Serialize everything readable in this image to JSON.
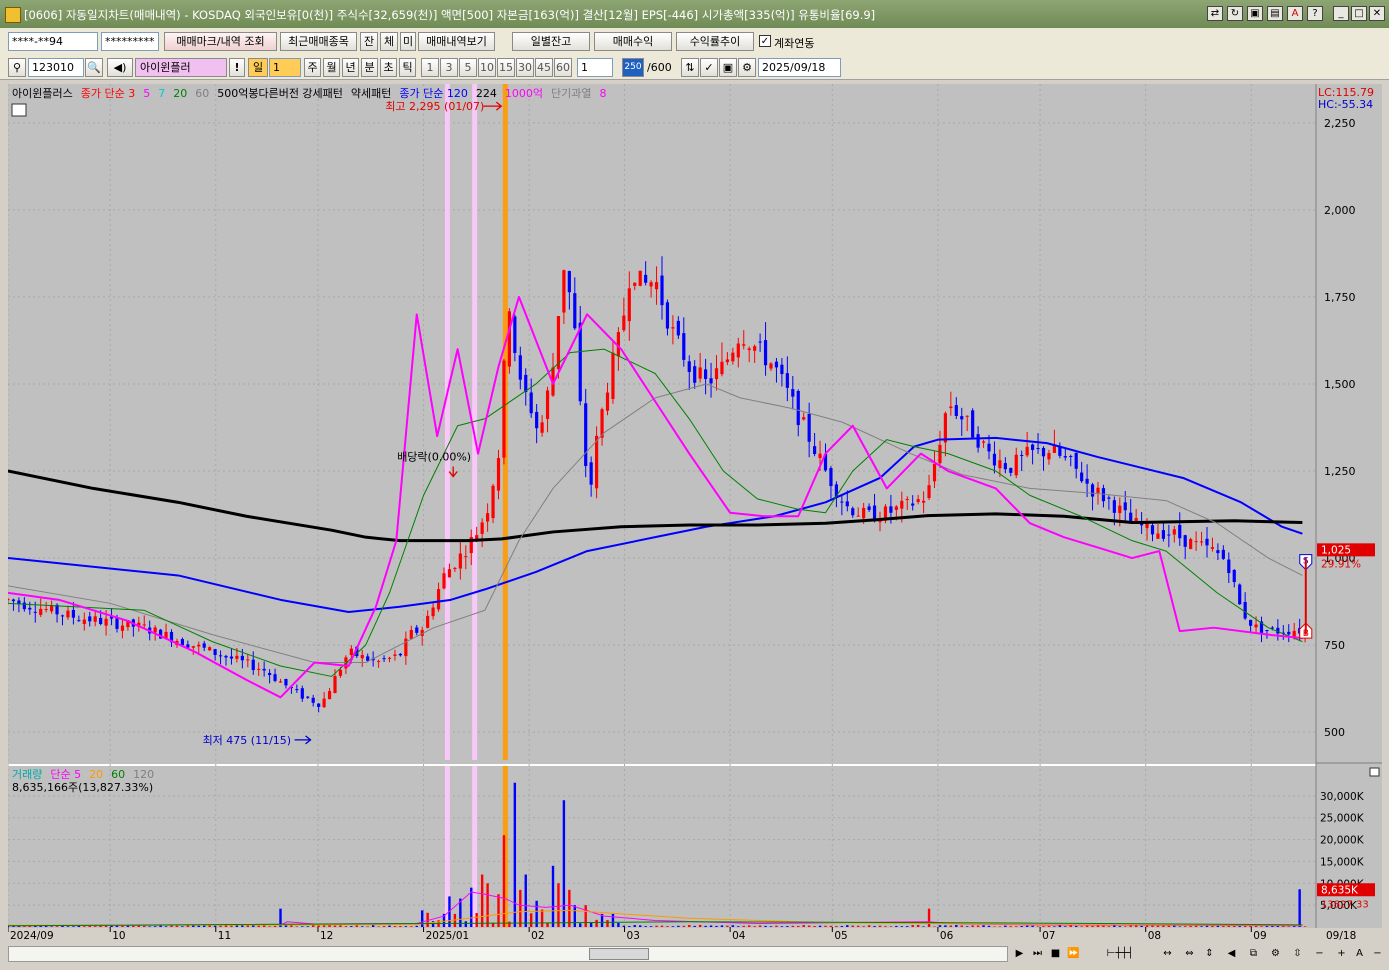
{
  "window": {
    "title": "[0606] 자동일지차트(매매내역) - KOSDAQ 외국인보유[0(천)] 주식수[32,659(천)] 액면[500] 자본금[163(억)] 결산[12월] EPS[-446] 시가총액[335(억)] 유통비율[69.9]"
  },
  "toolbar1": {
    "account": "****-**94",
    "password": "*********",
    "btn_trade_mark": "매매마크/내역 조회",
    "btn_recent": "최근매매종목",
    "btn_jan": "잔",
    "btn_che": "체",
    "btn_mi": "미",
    "btn_history": "매매내역보기",
    "btn_daily_balance": "일별잔고",
    "btn_trade_profit": "매매수익",
    "btn_return_trend": "수익률추이",
    "checkbox_link_label": "계좌연동"
  },
  "toolbar2": {
    "stock_code": "123010",
    "stock_name": "아이윈플러",
    "period_selected": "일",
    "period_value": "1",
    "periods": [
      "주",
      "월",
      "년",
      "분",
      "초",
      "틱"
    ],
    "intervals": [
      "1",
      "3",
      "5",
      "10",
      "15",
      "30",
      "45",
      "60"
    ],
    "interval_value": "1",
    "count_badge": "250",
    "count_total": "/600",
    "date": "2025/09/18"
  },
  "price_panel": {
    "legend": [
      {
        "text": "아이윈플러스",
        "color": "#000000"
      },
      {
        "text": "종가 단순 3",
        "color": "#ff0000"
      },
      {
        "text": "5",
        "color": "#ff00ff"
      },
      {
        "text": "7",
        "color": "#00cccc"
      },
      {
        "text": "20",
        "color": "#008000"
      },
      {
        "text": "60",
        "color": "#808080"
      },
      {
        "text": "500억봉다른버전 강세패턴",
        "color": "#000000"
      },
      {
        "text": "약세패턴",
        "color": "#000000"
      },
      {
        "text": "종가 단순 120",
        "color": "#0000ff"
      },
      {
        "text": "224",
        "color": "#000000"
      },
      {
        "text": "1000억",
        "color": "#ff00ff"
      },
      {
        "text": "단기과열",
        "color": "#808080"
      },
      {
        "text": "8",
        "color": "#ff00ff"
      }
    ],
    "lc_label": "LC:115.79",
    "hc_label": "HC:-55.34",
    "current_price_label": "1,025",
    "current_change_label": "29.91%",
    "annotation_high": "최고 2,295 (01/07)",
    "annotation_low": "최저 475 (11/15)",
    "annotation_dividend": "배당락(0.00%)",
    "marker_s": "S",
    "marker_b": "B"
  },
  "volume_panel": {
    "legend": [
      {
        "text": "거래량",
        "color": "#00aaaa"
      },
      {
        "text": "단순 5",
        "color": "#ff00ff"
      },
      {
        "text": "20",
        "color": "#ff9900"
      },
      {
        "text": "60",
        "color": "#008000"
      },
      {
        "text": "120",
        "color": "#808080"
      }
    ],
    "summary": "8,635,166주(13,827.33%)",
    "current_volume_label": "8,635K",
    "current_ratio_label": "13827.33"
  },
  "chart_data": {
    "type": "line",
    "title": "아이윈플러스",
    "xlabel": "",
    "ylabel": "",
    "y_ticks": [
      500,
      750,
      1000,
      1250,
      1500,
      1750,
      2000,
      2250
    ],
    "ylim": [
      420,
      2350
    ],
    "x_ticks": [
      "2024/09",
      "10",
      "11",
      "12",
      "2025/01",
      "02",
      "03",
      "04",
      "05",
      "06",
      "07",
      "08",
      "09",
      "09/18"
    ],
    "x_range_days": [
      0,
      384
    ],
    "grid": true,
    "series": [
      {
        "name": "종가 단순 120",
        "color": "#0000ff",
        "points": [
          [
            0,
            1000
          ],
          [
            50,
            950
          ],
          [
            80,
            880
          ],
          [
            100,
            845
          ],
          [
            115,
            860
          ],
          [
            130,
            880
          ],
          [
            140,
            910
          ],
          [
            155,
            960
          ],
          [
            170,
            1020
          ],
          [
            190,
            1060
          ],
          [
            205,
            1090
          ],
          [
            225,
            1120
          ],
          [
            240,
            1160
          ],
          [
            256,
            1230
          ],
          [
            266,
            1320
          ],
          [
            273,
            1340
          ],
          [
            290,
            1345
          ],
          [
            305,
            1330
          ],
          [
            320,
            1290
          ],
          [
            345,
            1230
          ],
          [
            362,
            1160
          ],
          [
            374,
            1090
          ],
          [
            380,
            1070
          ]
        ]
      },
      {
        "name": "224",
        "color": "#000000",
        "points": [
          [
            0,
            1250
          ],
          [
            25,
            1200
          ],
          [
            50,
            1160
          ],
          [
            70,
            1120
          ],
          [
            95,
            1080
          ],
          [
            105,
            1060
          ],
          [
            115,
            1050
          ],
          [
            135,
            1050
          ],
          [
            145,
            1055
          ],
          [
            160,
            1075
          ],
          [
            180,
            1090
          ],
          [
            200,
            1095
          ],
          [
            220,
            1095
          ],
          [
            240,
            1100
          ],
          [
            255,
            1110
          ],
          [
            270,
            1122
          ],
          [
            290,
            1127
          ],
          [
            310,
            1120
          ],
          [
            330,
            1102
          ],
          [
            360,
            1107
          ],
          [
            380,
            1102
          ]
        ]
      },
      {
        "name": "60",
        "color": "#808080",
        "points": [
          [
            0,
            920
          ],
          [
            30,
            870
          ],
          [
            60,
            780
          ],
          [
            90,
            700
          ],
          [
            105,
            700
          ],
          [
            125,
            800
          ],
          [
            140,
            850
          ],
          [
            150,
            1050
          ],
          [
            160,
            1200
          ],
          [
            175,
            1360
          ],
          [
            190,
            1460
          ],
          [
            205,
            1500
          ],
          [
            215,
            1460
          ],
          [
            230,
            1430
          ],
          [
            245,
            1390
          ],
          [
            265,
            1300
          ],
          [
            280,
            1240
          ],
          [
            300,
            1200
          ],
          [
            320,
            1185
          ],
          [
            340,
            1165
          ],
          [
            355,
            1100
          ],
          [
            370,
            1000
          ],
          [
            380,
            950
          ]
        ]
      },
      {
        "name": "20",
        "color": "#008000",
        "points": [
          [
            0,
            870
          ],
          [
            40,
            850
          ],
          [
            60,
            760
          ],
          [
            80,
            690
          ],
          [
            95,
            660
          ],
          [
            105,
            750
          ],
          [
            112,
            900
          ],
          [
            122,
            1180
          ],
          [
            132,
            1380
          ],
          [
            140,
            1400
          ],
          [
            155,
            1500
          ],
          [
            165,
            1590
          ],
          [
            175,
            1600
          ],
          [
            190,
            1530
          ],
          [
            200,
            1400
          ],
          [
            210,
            1250
          ],
          [
            220,
            1170
          ],
          [
            232,
            1140
          ],
          [
            240,
            1130
          ],
          [
            248,
            1250
          ],
          [
            258,
            1340
          ],
          [
            266,
            1320
          ],
          [
            276,
            1300
          ],
          [
            290,
            1250
          ],
          [
            300,
            1180
          ],
          [
            315,
            1120
          ],
          [
            330,
            1050
          ],
          [
            340,
            1020
          ],
          [
            355,
            900
          ],
          [
            370,
            800
          ],
          [
            380,
            760
          ]
        ]
      },
      {
        "name": "5",
        "color": "#ff00ff",
        "points": [
          [
            0,
            900
          ],
          [
            15,
            880
          ],
          [
            35,
            820
          ],
          [
            55,
            730
          ],
          [
            70,
            650
          ],
          [
            80,
            600
          ],
          [
            90,
            700
          ],
          [
            100,
            690
          ],
          [
            108,
            860
          ],
          [
            114,
            1050
          ],
          [
            120,
            1700
          ],
          [
            126,
            1350
          ],
          [
            132,
            1600
          ],
          [
            138,
            1300
          ],
          [
            144,
            1550
          ],
          [
            150,
            1750
          ],
          [
            160,
            1500
          ],
          [
            170,
            1700
          ],
          [
            180,
            1600
          ],
          [
            190,
            1450
          ],
          [
            200,
            1300
          ],
          [
            212,
            1130
          ],
          [
            222,
            1120
          ],
          [
            232,
            1120
          ],
          [
            240,
            1300
          ],
          [
            248,
            1380
          ],
          [
            258,
            1200
          ],
          [
            268,
            1300
          ],
          [
            276,
            1250
          ],
          [
            290,
            1200
          ],
          [
            300,
            1100
          ],
          [
            310,
            1060
          ],
          [
            320,
            1030
          ],
          [
            330,
            1000
          ],
          [
            338,
            1020
          ],
          [
            344,
            790
          ],
          [
            354,
            800
          ],
          [
            370,
            780
          ],
          [
            380,
            770
          ]
        ]
      }
    ],
    "volume_ticks_k": [
      5000,
      10000,
      15000,
      20000,
      25000,
      30000
    ],
    "volume_ylim_k": [
      0,
      35000
    ]
  }
}
